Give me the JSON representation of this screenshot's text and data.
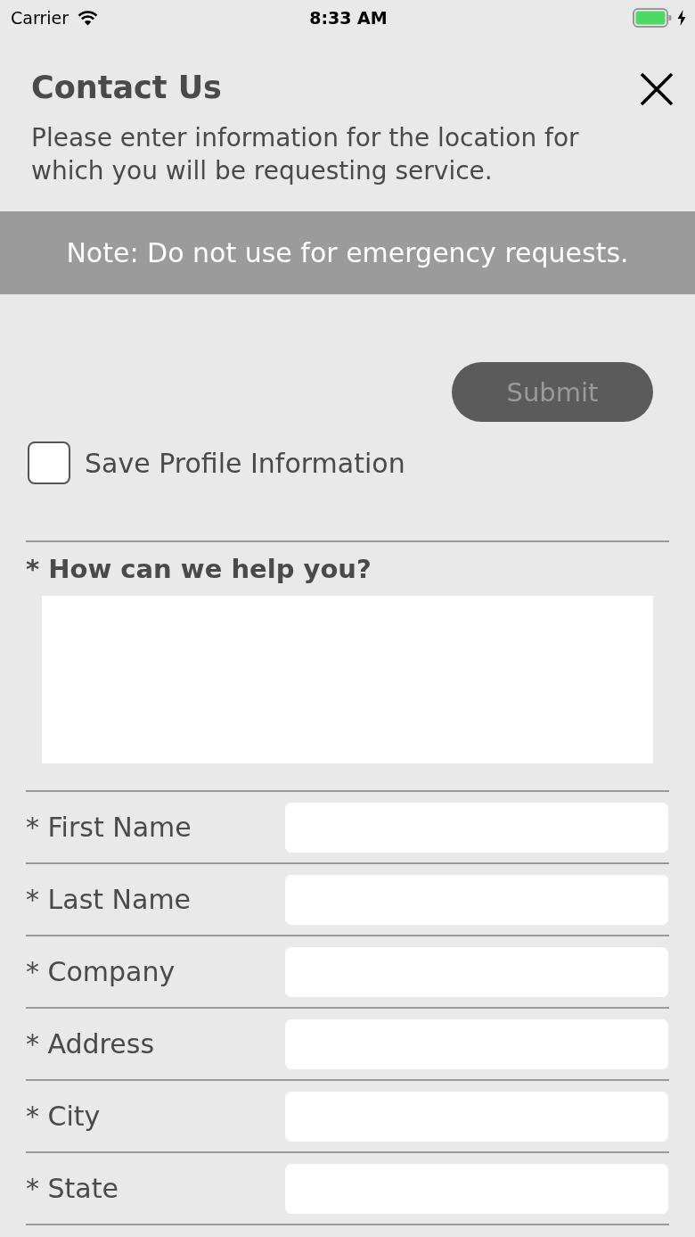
{
  "status_bar": {
    "carrier": "Carrier",
    "time": "8:33 AM"
  },
  "header": {
    "title": "Contact Us",
    "subtitle": "Please enter information for the location for which you will be requesting service."
  },
  "note": "Note: Do not use for emergency requests.",
  "submit": {
    "label": "Submit",
    "disabled": true
  },
  "save_profile": {
    "label": "Save Profile Information",
    "checked": false
  },
  "message": {
    "label": "* How can we help you?"
  },
  "fields": [
    {
      "label": "* First Name"
    },
    {
      "label": "* Last Name"
    },
    {
      "label": "* Company"
    },
    {
      "label": "* Address"
    },
    {
      "label": "* City"
    },
    {
      "label": "* State"
    }
  ]
}
